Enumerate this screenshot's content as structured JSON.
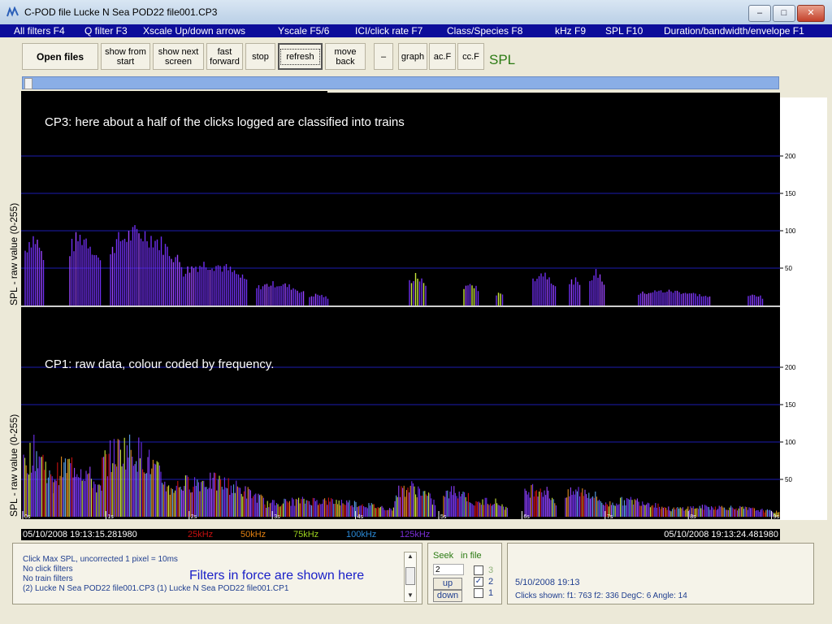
{
  "window": {
    "title": "C-POD file  Lucke N Sea POD22 file001.CP3",
    "controls": {
      "minimize": "–",
      "maximize": "□",
      "close": "✕"
    }
  },
  "menu": [
    "All filters F4",
    "Q filter F3",
    "Xscale Up/down arrows",
    "Yscale F5/6",
    "ICI/click rate F7",
    "Class/Species F8",
    "kHz F9",
    "SPL F10",
    "Duration/bandwidth/envelope F1"
  ],
  "toolbar": {
    "open_files": "Open files",
    "show_from_start": [
      "show from",
      "start"
    ],
    "show_next_screen": [
      "show next",
      "screen"
    ],
    "fast_forward": [
      "fast",
      "forward"
    ],
    "stop": "stop",
    "refresh": "refresh",
    "move_back": [
      "move",
      "back"
    ],
    "minus": "–",
    "graph": "graph",
    "ac_f": "ac.F",
    "cc_f": "cc.F",
    "mode_label": "SPL"
  },
  "plots": {
    "top_annotation": "CP3: here about a half of the clicks logged are classified into trains",
    "bottom_annotation": "CP1: raw data, colour coded by frequency.",
    "y_label": "SPL - raw value (0-255)",
    "y_ticks": [
      "200",
      "150",
      "100",
      "50"
    ],
    "x_ticks": [
      "0s",
      "1s",
      "2s",
      "3s",
      "4s",
      "5s",
      "6s",
      "7s",
      "8s",
      "9s"
    ]
  },
  "timebar": {
    "start": "05/10/2008 19:13:15.281980",
    "end": "05/10/2008 19:13:24.481980",
    "freq_legend": [
      {
        "label": "25kHz",
        "color": "#c81010"
      },
      {
        "label": "50kHz",
        "color": "#e07f10"
      },
      {
        "label": "75kHz",
        "color": "#9cd21e"
      },
      {
        "label": "100kHz",
        "color": "#2a8ad8"
      },
      {
        "label": "125kHz",
        "color": "#7a2ed8"
      }
    ]
  },
  "filters_panel": {
    "lines": [
      "Click Max SPL, uncorrected   1 pixel = 10ms",
      "No click filters",
      "No train filters",
      "(2) Lucke N Sea POD22 file001.CP3  (1) Lucke N Sea POD22 file001.CP1"
    ],
    "annotation": "Filters in force are shown here"
  },
  "seek_panel": {
    "label": "Seek",
    "in_file_label": "in file",
    "value": "2",
    "up": "up",
    "down": "down",
    "file_options": [
      {
        "label": "3",
        "checked": false,
        "dim": true
      },
      {
        "label": "2",
        "checked": true,
        "dim": false
      },
      {
        "label": "1",
        "checked": false,
        "dim": false
      }
    ]
  },
  "info_panel": {
    "datetime": "5/10/2008 19:13",
    "clicks": "Clicks shown:   f1: 763  f2: 336   DegC: 6  Angle: 14"
  }
}
